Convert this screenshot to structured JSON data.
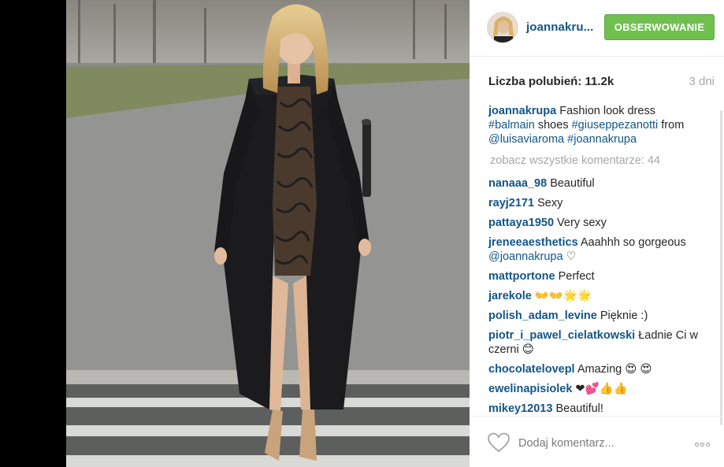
{
  "post": {
    "photo_alt": "",
    "author": "joannakru...",
    "follow_label": "OBSERWOWANIE",
    "likes_label": "Liczba polubień: 11.2k",
    "time_ago": "3 dni",
    "caption": {
      "user": "joannakrupa",
      "text1": " Fashion look dress ",
      "tag1": "#balmain",
      "text2": " shoes ",
      "tag2": "#giuseppezanotti",
      "text3": " from ",
      "tag3": "@luisaviaroma",
      "text4": " ",
      "tag4": "#joannakrupa"
    },
    "view_all_comments": "zobacz wszystkie komentarze: 44",
    "comments": [
      {
        "user": "nanaaa_98",
        "text": " Beautiful"
      },
      {
        "user": "rayj2171",
        "text": " Sexy"
      },
      {
        "user": "pattaya1950",
        "text": " Very sexy"
      },
      {
        "user": "jreneeaesthetics",
        "text": " Aaahhh so gorgeous ",
        "mention": "@joannakrupa",
        "suffix": " ♡"
      },
      {
        "user": "mattportone",
        "text": " Perfect"
      },
      {
        "user": "jarekole",
        "text": " 👐👐🌟🌟"
      },
      {
        "user": "polish_adam_levine",
        "text": " Pięknie :)"
      },
      {
        "user": "piotr_i_pawel_cielatkowski",
        "text": " Ładnie Ci w czerni 😊"
      },
      {
        "user": "chocolatelovepl",
        "text": " Amazing 😍 😍"
      },
      {
        "user": "ewelinapisiolek",
        "text": " ❤💕👍👍"
      },
      {
        "user": "mikey12013",
        "text": " Beautiful!"
      }
    ],
    "comment_placeholder": "Dodaj komentarz...",
    "icons": {
      "like": "heart-outline-icon",
      "more": "ellipsis-icon"
    }
  },
  "colors": {
    "link": "#125688",
    "follow_bg": "#70c050",
    "muted": "#a5a7aa"
  }
}
